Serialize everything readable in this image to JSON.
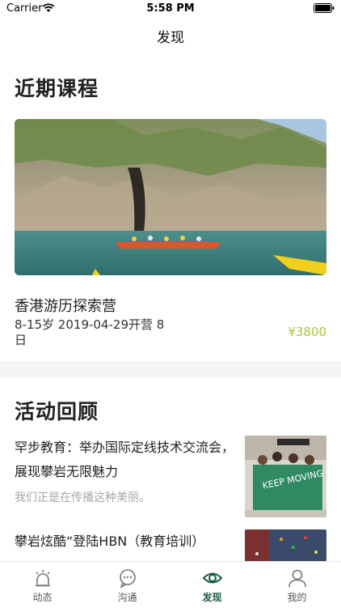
{
  "status_bar": {
    "carrier": "Carrier",
    "time": "5:58 PM"
  },
  "nav": {
    "title": "发现"
  },
  "courses": {
    "section_title": "近期课程",
    "items": [
      {
        "name": "香港游历探索营",
        "meta": "8-15岁 2019-04-29开营 8日",
        "price": "¥3800"
      }
    ]
  },
  "reviews": {
    "section_title": "活动回顾",
    "items": [
      {
        "title": "罕步教育：举办国际定线技术交流会，展现攀岩无限魅力",
        "subtitle": "我们正是在传播这种美丽。",
        "banner_text": "KEEP MOVING"
      },
      {
        "title": "攀岩炫酷“登陆HBN（教育培训）",
        "subtitle": ""
      }
    ]
  },
  "tab_bar": {
    "tabs": [
      {
        "label": "动态",
        "icon": "alarm-light-icon"
      },
      {
        "label": "沟通",
        "icon": "chat-bubble-icon"
      },
      {
        "label": "发现",
        "icon": "eye-icon"
      },
      {
        "label": "我的",
        "icon": "user-icon"
      }
    ],
    "active_index": 2
  },
  "colors": {
    "accent": "#1d5a4a",
    "price": "#a8c43a",
    "muted": "#a8a8a8"
  }
}
